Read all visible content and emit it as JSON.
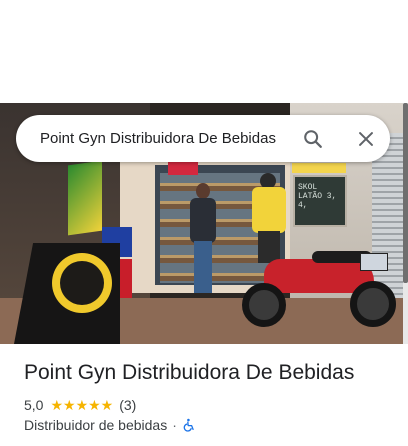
{
  "search": {
    "value": "Point Gyn Distribuidora De Bebidas"
  },
  "place": {
    "name": "Point Gyn Distribuidora De Bebidas",
    "rating": "5,0",
    "stars": "★★★★★",
    "review_count": "(3)",
    "category": "Distribuidor de bebidas",
    "separator": "·",
    "accessibility_icon": "wheelchair-icon"
  },
  "photo": {
    "chalkboard_text": "SKOL\nLATÃO 3,\n4,"
  },
  "colors": {
    "star": "#f6b400",
    "accessibility": "#1a73e8",
    "text_primary": "#202124",
    "text_secondary": "#3c4043"
  }
}
